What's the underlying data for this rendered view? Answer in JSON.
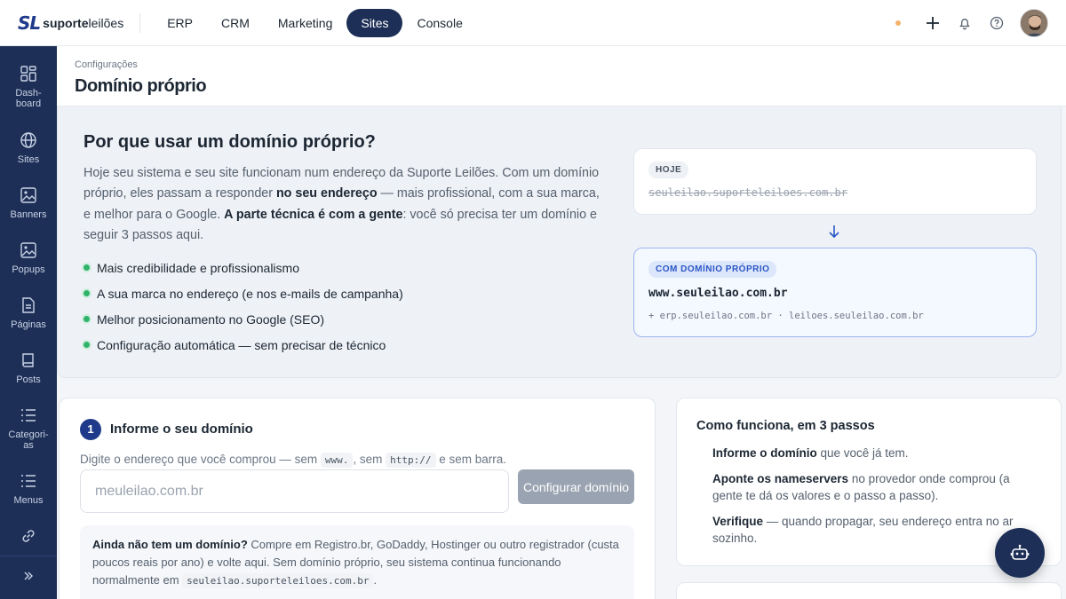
{
  "brand": {
    "mark": "SL",
    "name_bold": "suporte",
    "name_light": "leilões"
  },
  "topnav": [
    {
      "label": "ERP",
      "active": false
    },
    {
      "label": "CRM",
      "active": false
    },
    {
      "label": "Marketing",
      "active": false
    },
    {
      "label": "Sites",
      "active": true
    },
    {
      "label": "Console",
      "active": false
    }
  ],
  "topright": {
    "icons": [
      "status-dot",
      "plus-icon",
      "bell-icon",
      "help-icon",
      "avatar"
    ]
  },
  "sidebar": [
    {
      "label": "Dash-\nboard",
      "icon": "dashboard-icon"
    },
    {
      "label": "Sites",
      "icon": "globe-icon"
    },
    {
      "label": "Banners",
      "icon": "image-icon"
    },
    {
      "label": "Popups",
      "icon": "image-icon"
    },
    {
      "label": "Páginas",
      "icon": "file-icon"
    },
    {
      "label": "Posts",
      "icon": "book-icon"
    },
    {
      "label": "Categori-\nas",
      "icon": "list-icon"
    },
    {
      "label": "Menus",
      "icon": "list-icon"
    },
    {
      "label": "",
      "icon": "link-icon"
    },
    {
      "label": "",
      "icon": "expand-icon"
    }
  ],
  "header": {
    "breadcrumb": "Configurações",
    "title": "Domínio próprio"
  },
  "hero": {
    "title": "Por que usar um domínio próprio?",
    "desc_1": "Hoje seu sistema e seu site funcionam num endereço da Suporte Leilões. Com um domínio próprio, eles passam a responder ",
    "desc_bold_1": "no seu endereço",
    "desc_2": " — mais profissional, com a sua marca, e melhor para o Google. ",
    "desc_bold_2": "A parte técnica é com a gente",
    "desc_3": ": você só precisa ter um domínio e seguir 3 passos aqui.",
    "benefits": [
      "Mais credibilidade e profissionalismo",
      "A sua marca no endereço (e nos e-mails de campanha)",
      "Melhor posicionamento no Google (SEO)",
      "Configuração automática — sem precisar de técnico"
    ],
    "today_tag": "HOJE",
    "today_domain": "seuleilao.suporteleiloes.com.br",
    "own_tag": "COM DOMÍNIO PRÓPRIO",
    "own_domain": "www.seuleilao.com.br",
    "own_sub": "+ erp.seuleilao.com.br · leiloes.seuleilao.com.br"
  },
  "step1": {
    "number": "1",
    "title": "Informe o seu domínio",
    "hint_1": "Digite o endereço que você comprou — sem ",
    "hint_code_1": "www.",
    "hint_2": ", sem ",
    "hint_code_2": "http://",
    "hint_3": " e sem barra.",
    "input_placeholder": "meuleilao.com.br",
    "input_value": "",
    "button": "Configurar domínio",
    "nodomain_bold": "Ainda não tem um domínio?",
    "nodomain_text": " Compre em Registro.br, GoDaddy, Hostinger ou outro registrador (custa poucos reais por ano) e volte aqui. Sem domínio próprio, seu sistema continua funcionando normalmente em ",
    "nodomain_code": "seuleilao.suporteleiloes.com.br",
    "nodomain_end": "."
  },
  "how": {
    "title": "Como funciona, em 3 passos",
    "steps": [
      {
        "bold": "Informe o domínio",
        "text": " que você já tem."
      },
      {
        "bold": "Aponte os nameservers",
        "text": " no provedor onde comprou (a gente te dá os valores e o passo a passo)."
      },
      {
        "bold": "Verifique",
        "text": " — quando propagar, seu endereço entra no ar sozinho."
      }
    ]
  },
  "colors": {
    "navy": "#1d2f56",
    "accent": "#1f3a8a",
    "green": "#2fb36a",
    "button_disabled": "#9aa3b1"
  }
}
